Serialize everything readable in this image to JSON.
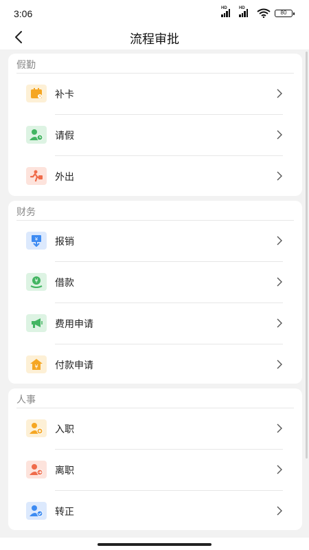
{
  "status": {
    "time": "3:06",
    "battery": "80",
    "hd1": "HD",
    "hd2": "HD"
  },
  "nav": {
    "title": "流程审批"
  },
  "sections": [
    {
      "title": "假勤",
      "items": [
        {
          "label": "补卡",
          "icon": "card-replace-icon"
        },
        {
          "label": "请假",
          "icon": "leave-icon"
        },
        {
          "label": "外出",
          "icon": "go-out-icon"
        }
      ]
    },
    {
      "title": "财务",
      "items": [
        {
          "label": "报销",
          "icon": "reimbursement-icon"
        },
        {
          "label": "借款",
          "icon": "loan-icon"
        },
        {
          "label": "费用申请",
          "icon": "expense-application-icon"
        },
        {
          "label": "付款申请",
          "icon": "payment-application-icon"
        }
      ]
    },
    {
      "title": "人事",
      "items": [
        {
          "label": "入职",
          "icon": "onboarding-icon"
        },
        {
          "label": "离职",
          "icon": "resignation-icon"
        },
        {
          "label": "转正",
          "icon": "regularization-icon"
        }
      ]
    }
  ],
  "colors": {
    "orange": "#f5a623",
    "orange_bg": "#fdf0d6",
    "green": "#43b562",
    "green_bg": "#ddf3e3",
    "red": "#ef6b4a",
    "red_bg": "#fde3dc",
    "blue": "#3d8bf2",
    "blue_bg": "#dce9fd"
  }
}
